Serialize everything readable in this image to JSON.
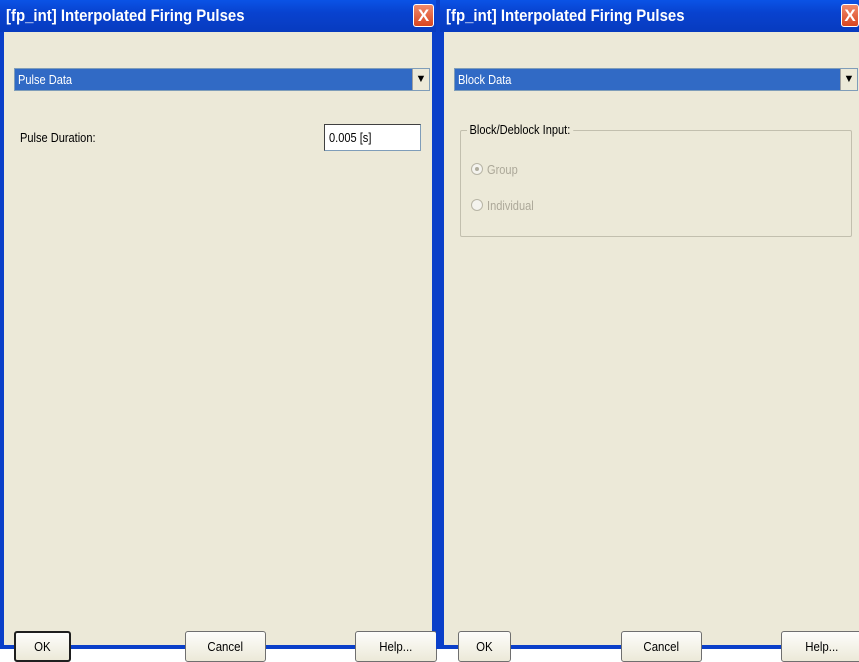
{
  "left_dialog": {
    "title": "[fp_int] Interpolated Firing Pulses",
    "close_symbol": "X",
    "section_dropdown": {
      "selected": "Pulse Data"
    },
    "fields": {
      "pulse_duration_label": "Pulse Duration:",
      "pulse_duration_value": "0.005 [s]"
    },
    "buttons": {
      "ok": "OK",
      "cancel": "Cancel",
      "help": "Help..."
    }
  },
  "right_dialog": {
    "title": "[fp_int] Interpolated Firing Pulses",
    "close_symbol": "X",
    "section_dropdown": {
      "selected": "Block Data"
    },
    "group": {
      "legend": "Block/Deblock Input:",
      "options": [
        {
          "label": "Group",
          "checked": true,
          "enabled": false
        },
        {
          "label": "Individual",
          "checked": false,
          "enabled": false
        }
      ]
    },
    "buttons": {
      "ok": "OK",
      "cancel": "Cancel",
      "help": "Help..."
    }
  },
  "icons": {
    "close": "close-icon",
    "dropdown": "chevron-down-icon",
    "radio": "radio-button-icon"
  },
  "colors": {
    "titlebar": "#0842cf",
    "close_button": "#d9451f",
    "dialog_background": "#ece9d8",
    "selection": "#316ac5",
    "disabled_text": "#aca899"
  }
}
